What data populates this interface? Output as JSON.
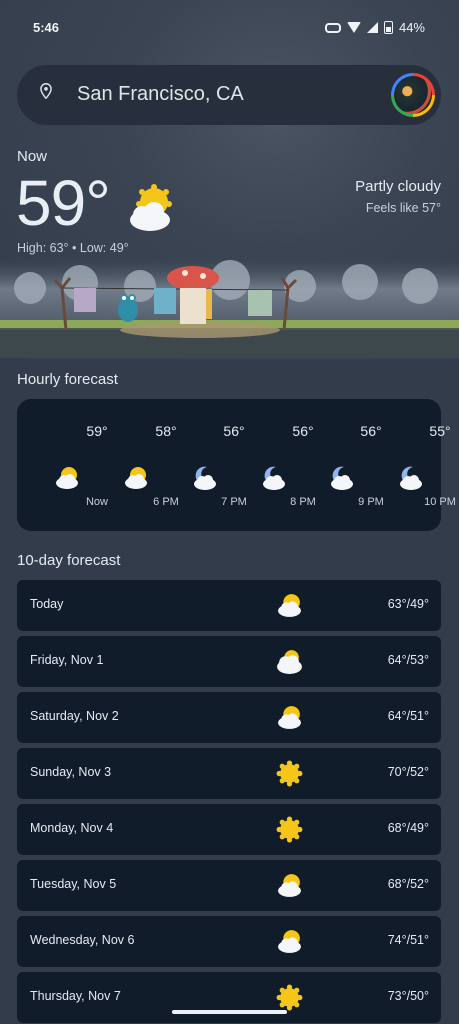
{
  "status": {
    "time": "5:46",
    "battery": "44%"
  },
  "search": {
    "location": "San Francisco, CA"
  },
  "now": {
    "label": "Now",
    "temp": "59°",
    "hilo": "High: 63° • Low: 49°",
    "condition": "Partly cloudy",
    "feels": "Feels like 57°",
    "icon": "partly-cloudy-icon"
  },
  "hourly": {
    "title": "Hourly forecast",
    "items": [
      {
        "temp": "59°",
        "label": "Now",
        "icon": "partly-cloudy-icon"
      },
      {
        "temp": "58°",
        "label": "6 PM",
        "icon": "partly-cloudy-icon"
      },
      {
        "temp": "56°",
        "label": "7 PM",
        "icon": "partly-cloudy-night-icon"
      },
      {
        "temp": "56°",
        "label": "8 PM",
        "icon": "partly-cloudy-night-icon"
      },
      {
        "temp": "56°",
        "label": "9 PM",
        "icon": "partly-cloudy-night-icon"
      },
      {
        "temp": "55°",
        "label": "10 PM",
        "icon": "partly-cloudy-night-icon"
      }
    ]
  },
  "daily": {
    "title": "10-day forecast",
    "items": [
      {
        "name": "Today",
        "temps": "63°/49°",
        "icon": "partly-cloudy-icon"
      },
      {
        "name": "Friday, Nov 1",
        "temps": "64°/53°",
        "icon": "mostly-cloudy-icon"
      },
      {
        "name": "Saturday, Nov 2",
        "temps": "64°/51°",
        "icon": "partly-cloudy-icon"
      },
      {
        "name": "Sunday, Nov 3",
        "temps": "70°/52°",
        "icon": "sunny-icon"
      },
      {
        "name": "Monday, Nov 4",
        "temps": "68°/49°",
        "icon": "sunny-icon"
      },
      {
        "name": "Tuesday, Nov 5",
        "temps": "68°/52°",
        "icon": "partly-cloudy-icon"
      },
      {
        "name": "Wednesday, Nov 6",
        "temps": "74°/51°",
        "icon": "partly-cloudy-icon"
      },
      {
        "name": "Thursday, Nov 7",
        "temps": "73°/50°",
        "icon": "sunny-icon"
      }
    ]
  },
  "colors": {
    "background": "#323c4a",
    "card": "#101c2a",
    "sun": "#f5c518"
  }
}
